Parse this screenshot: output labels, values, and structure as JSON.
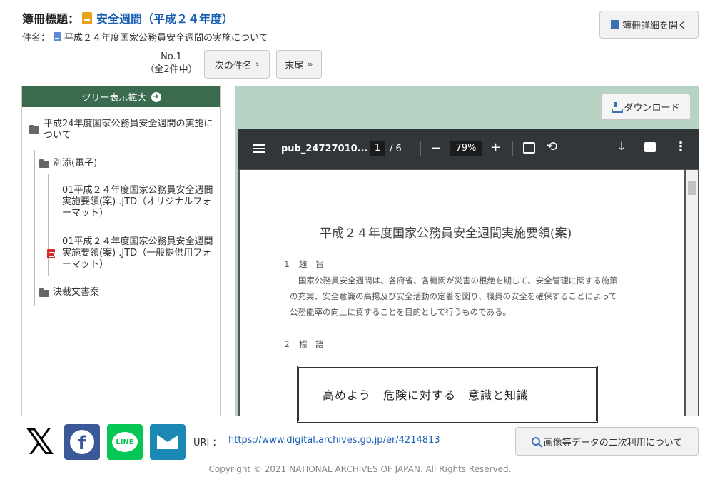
{
  "header": {
    "title_label": "簿冊標題：",
    "title_value": "安全週間（平成２４年度）",
    "subject_label": "件名：",
    "subject_value": "平成２４年度国家公務員安全週間の実施について",
    "detail_button": "簿冊詳細を開く"
  },
  "navigation": {
    "number": "No.1",
    "total": "（全2件中）",
    "next_button": "次の件名",
    "last_button": "末尾"
  },
  "tree": {
    "header": "ツリー表示拡大",
    "root": "平成24年度国家公務員安全週間の実施について",
    "folder1": "別添(電子)",
    "item1": "01平成２４年度国家公務員安全週間実施要領(案) .JTD（オリジナルフォーマット）",
    "item2": "01平成２４年度国家公務員安全週間実施要領(案) .JTD（一般提供用フォーマット）",
    "folder2": "決裁文書案"
  },
  "viewer": {
    "download_button": "ダウンロード",
    "filename": "pub_24727010...",
    "page_current": "1",
    "page_total": "/  6",
    "zoom": "79%"
  },
  "document": {
    "title": "平成２４年度国家公務員安全週間実施要領(案)",
    "section1_heading": "１　趣　旨",
    "section1_line1": "国家公務員安全週間は、各府省、各機関が災害の根絶を期して、安全管理に関する施策",
    "section1_line2": "の充実、安全意識の高揚及び安全活動の定着を図り、職員の安全を確保することによって",
    "section1_line3": "公務能率の向上に資することを目的として行うものである。",
    "section2_heading": "２　標　語",
    "motto": "高めよう　危険に対する　意識と知識"
  },
  "footer": {
    "uri_label": "URI ：",
    "uri_value": "https://www.digital.archives.go.jp/er/4214813",
    "reuse_button": "画像等データの二次利用について",
    "copyright": "Copyright © 2021 NATIONAL ARCHIVES OF JAPAN. All Rights Reserved."
  },
  "colors": {
    "tree_header_bg": "#3b6b4e",
    "viewer_bg": "#b6d3c4",
    "pdf_toolbar_bg": "#323639",
    "link": "#1a5fb4"
  }
}
